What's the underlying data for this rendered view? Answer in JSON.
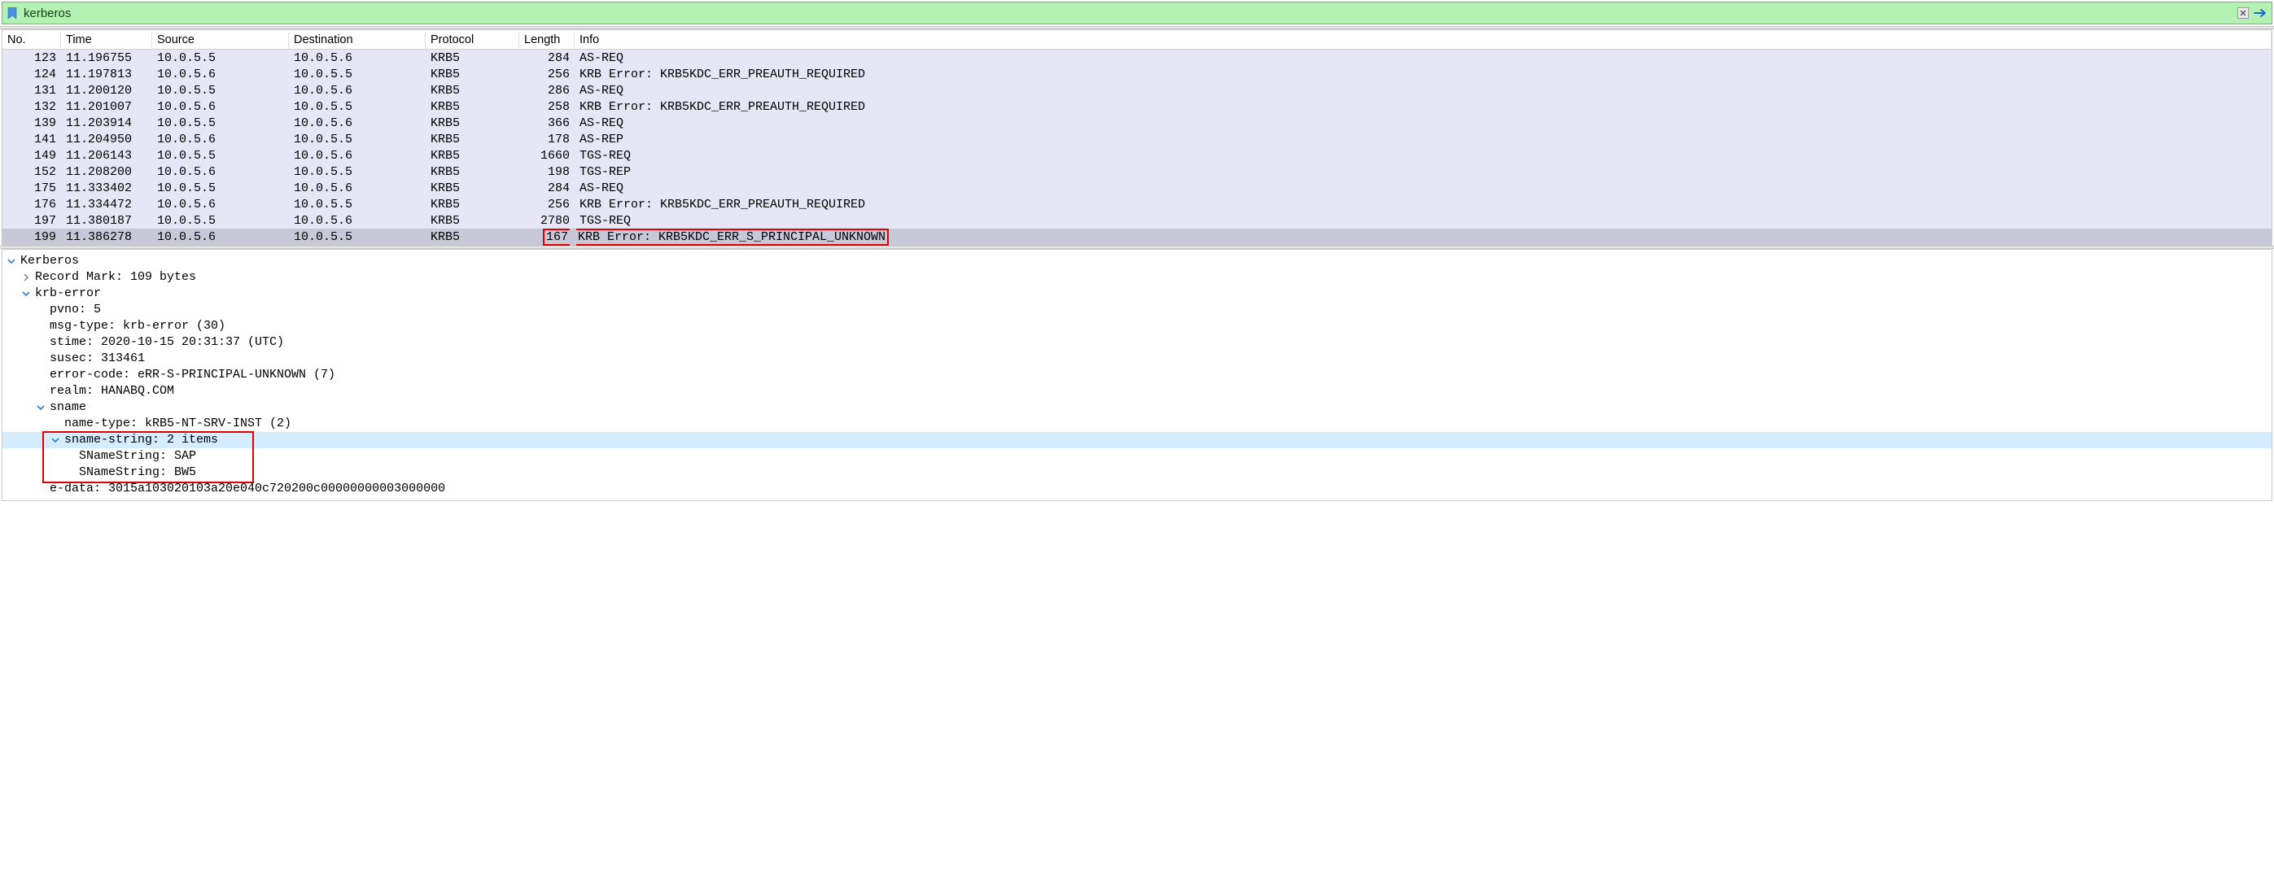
{
  "filter": {
    "value": "kerberos"
  },
  "packet_list": {
    "columns": [
      "No.",
      "Time",
      "Source",
      "Destination",
      "Protocol",
      "Length",
      "Info"
    ],
    "rows": [
      {
        "no": "123",
        "time": "11.196755",
        "src": "10.0.5.5",
        "dst": "10.0.5.6",
        "proto": "KRB5",
        "len": "284",
        "info": "AS-REQ"
      },
      {
        "no": "124",
        "time": "11.197813",
        "src": "10.0.5.6",
        "dst": "10.0.5.5",
        "proto": "KRB5",
        "len": "256",
        "info": "KRB Error: KRB5KDC_ERR_PREAUTH_REQUIRED"
      },
      {
        "no": "131",
        "time": "11.200120",
        "src": "10.0.5.5",
        "dst": "10.0.5.6",
        "proto": "KRB5",
        "len": "286",
        "info": "AS-REQ"
      },
      {
        "no": "132",
        "time": "11.201007",
        "src": "10.0.5.6",
        "dst": "10.0.5.5",
        "proto": "KRB5",
        "len": "258",
        "info": "KRB Error: KRB5KDC_ERR_PREAUTH_REQUIRED"
      },
      {
        "no": "139",
        "time": "11.203914",
        "src": "10.0.5.5",
        "dst": "10.0.5.6",
        "proto": "KRB5",
        "len": "366",
        "info": "AS-REQ"
      },
      {
        "no": "141",
        "time": "11.204950",
        "src": "10.0.5.6",
        "dst": "10.0.5.5",
        "proto": "KRB5",
        "len": "178",
        "info": "AS-REP"
      },
      {
        "no": "149",
        "time": "11.206143",
        "src": "10.0.5.5",
        "dst": "10.0.5.6",
        "proto": "KRB5",
        "len": "1660",
        "info": "TGS-REQ"
      },
      {
        "no": "152",
        "time": "11.208200",
        "src": "10.0.5.6",
        "dst": "10.0.5.5",
        "proto": "KRB5",
        "len": "198",
        "info": "TGS-REP"
      },
      {
        "no": "175",
        "time": "11.333402",
        "src": "10.0.5.5",
        "dst": "10.0.5.6",
        "proto": "KRB5",
        "len": "284",
        "info": "AS-REQ"
      },
      {
        "no": "176",
        "time": "11.334472",
        "src": "10.0.5.6",
        "dst": "10.0.5.5",
        "proto": "KRB5",
        "len": "256",
        "info": "KRB Error: KRB5KDC_ERR_PREAUTH_REQUIRED"
      },
      {
        "no": "197",
        "time": "11.380187",
        "src": "10.0.5.5",
        "dst": "10.0.5.6",
        "proto": "KRB5",
        "len": "2780",
        "info": "TGS-REQ"
      },
      {
        "no": "199",
        "time": "11.386278",
        "src": "10.0.5.6",
        "dst": "10.0.5.5",
        "proto": "KRB5",
        "len": "167",
        "info": "KRB Error: KRB5KDC_ERR_S_PRINCIPAL_UNKNOWN",
        "selected": true,
        "red_info": true
      }
    ]
  },
  "details": {
    "root_label": "Kerberos",
    "record_mark": "Record Mark: 109 bytes",
    "krb_error_label": "krb-error",
    "pvno": "pvno: 5",
    "msg_type": "msg-type: krb-error (30)",
    "stime": "stime: 2020-10-15 20:31:37 (UTC)",
    "susec": "susec: 313461",
    "error_code": "error-code: eRR-S-PRINCIPAL-UNKNOWN (7)",
    "realm": "realm: HANABQ.COM",
    "sname_label": "sname",
    "name_type": "name-type: kRB5-NT-SRV-INST (2)",
    "sname_string_label": "sname-string: 2 items",
    "sname_string_0": "SNameString: SAP",
    "sname_string_1": "SNameString: BW5",
    "e_data": "e-data: 3015a103020103a20e040c720200c00000000003000000"
  }
}
